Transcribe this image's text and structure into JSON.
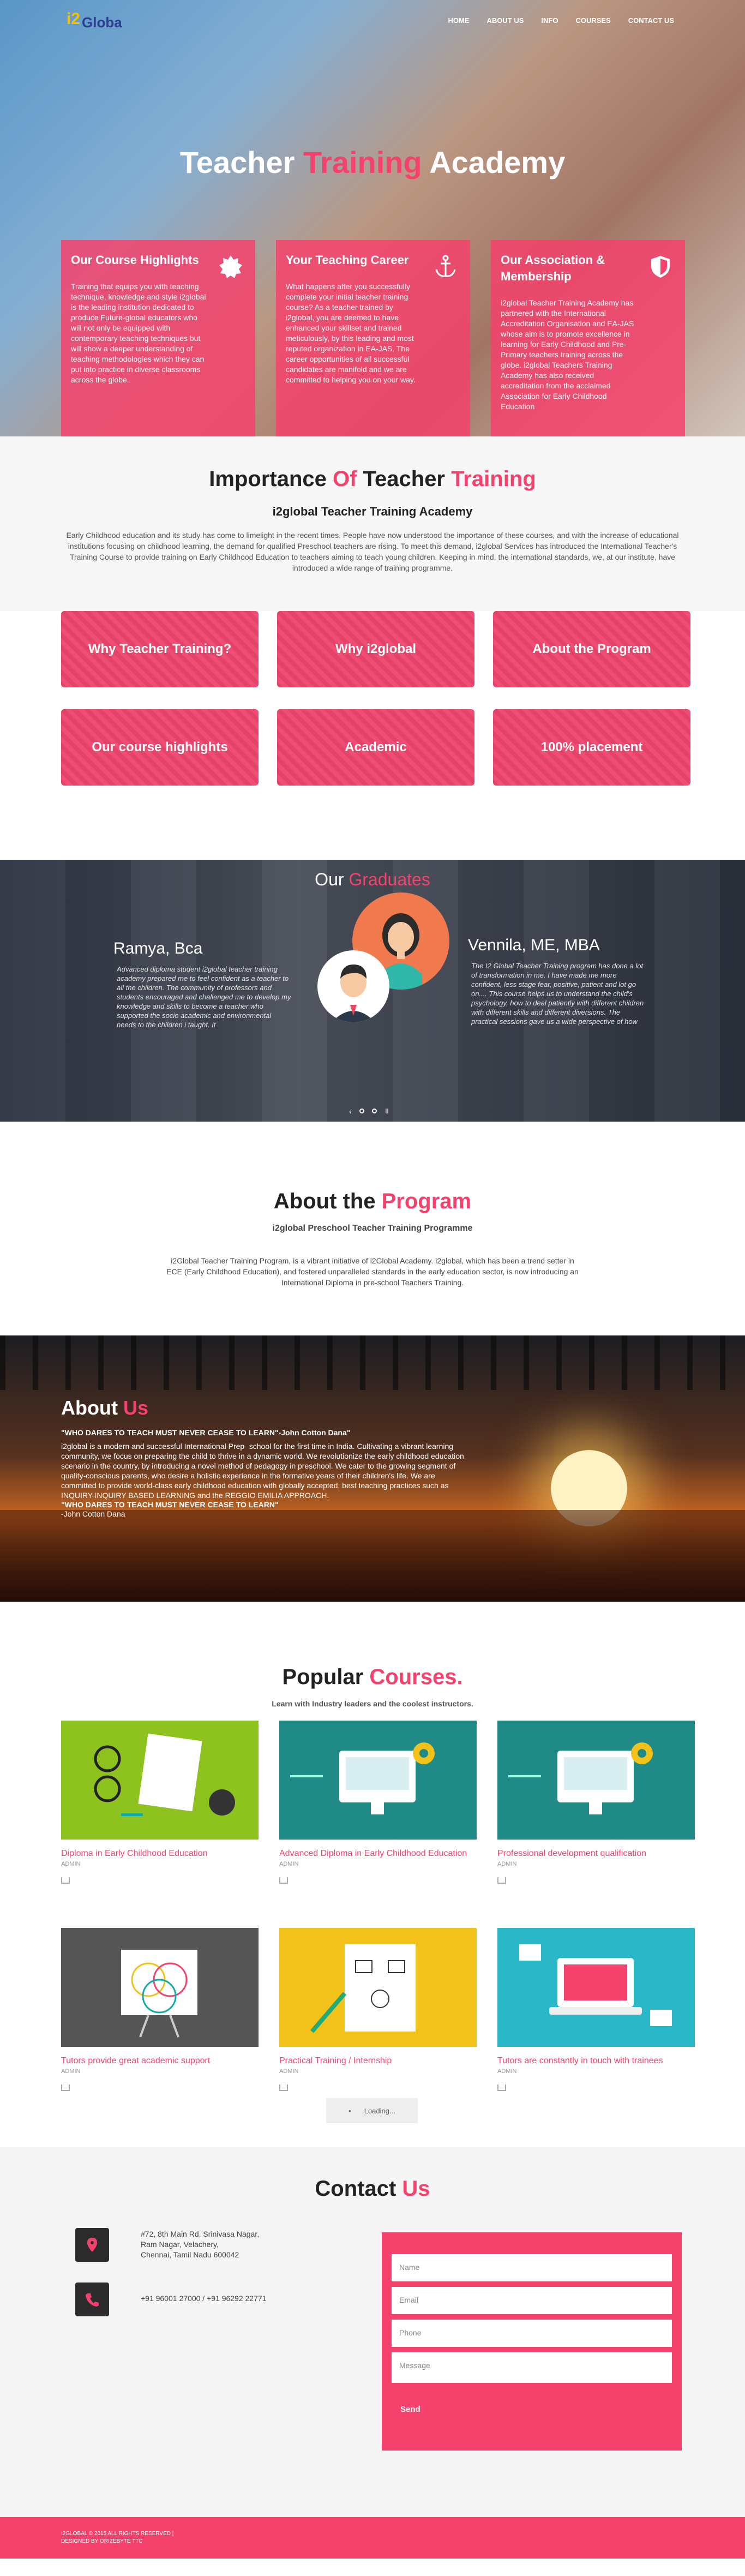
{
  "nav": {
    "logo_text": "Globa",
    "items": [
      "HOME",
      "ABOUT US",
      "INFO",
      "COURSES",
      "CONTACT US"
    ]
  },
  "hero": {
    "title_a": "Teacher ",
    "title_b": "Training",
    "title_c": " Academy",
    "cards": [
      {
        "title": "Our Course Highlights",
        "text": "Training that equips you with teaching technique, knowledge and style i2global is the leading institution dedicated to produce Future-global educators who will not only be equipped with contemporary teaching techniques but will show a deeper understanding of teaching methodologies which they can put into practice in diverse classrooms across the globe."
      },
      {
        "title": "Your Teaching Career",
        "text": "What happens after you successfully complete your initial teacher training course? As a teacher trained by i2global, you are deemed to have enhanced your skillset and trained meticulously, by this leading and most reputed organization in EA-JAS. The career opportunities of all successful candidates are manifold and we are committed to helping you on your way."
      },
      {
        "title": "Our Association & Membership",
        "text": "i2global Teacher Training Academy has partnered with the International Accreditation Organisation and EA-JAS whose aim is to promote excellence in learning for Early Childhood and Pre-Primary teachers training across the globe. i2global Teachers Training Academy has also received accreditation from the acclaimed Association for Early Childhood Education"
      }
    ]
  },
  "importance": {
    "title_a": "Importance ",
    "title_b": "Of",
    "title_c": " Teacher ",
    "title_d": "Training",
    "subtitle": "i2global Teacher Training Academy",
    "text": "Early Childhood education and its study has come to limelight in the recent times. People have now understood the importance of these courses, and with the increase of educational institutions focusing on childhood learning, the demand for qualified Preschool teachers are rising. To meet this demand, i2global Services has introduced the International Teacher's Training Course to provide training on Early Childhood Education to teachers aiming to teach young children. Keeping in mind, the international standards, we, at our institute, have introduced a wide range of training programme."
  },
  "tiles": [
    "Why Teacher Training?",
    "Why i2global",
    "About the Program",
    "Our course highlights",
    "Academic",
    "100% placement"
  ],
  "graduates": {
    "title_a": "Our ",
    "title_b": "Graduates",
    "left_name": "Ramya, Bca",
    "left_text": "Advanced diploma student i2global teacher training academy prepared me to feel confident as a teacher to all the children. The community of professors and students encouraged and challenged me to develop my knowledge and skills to become a teacher who supported the socio academic and environmental needs to the children i taught. It",
    "right_name": "Vennila, ME, MBA",
    "right_text": "The I2 Global Teacher Training program has done a lot of transformation in me. I have made me more confident, less stage fear, positive, patient and lot go on.... This course helps us to understand the child's psychology, how to deal patiently with different children with different skills and different diversions. The practical sessions gave us a wide perspective of how"
  },
  "program": {
    "title_a": "About the ",
    "title_b": "Program",
    "subtitle": "i2global Preschool Teacher Training Programme",
    "text": "i2Global Teacher Training Program, is a vibrant initiative of i2Global Academy. i2global, which has been a trend setter in ECE (Early Childhood Education), and fostered unparalleled standards in the early education sector, is now introducing an International Diploma in pre-school Teachers Training."
  },
  "aboutus": {
    "title_a": "About ",
    "title_b": "Us",
    "quote": "\"WHO DARES TO TEACH MUST NEVER CEASE TO LEARN\"-John Cotton Dana\"",
    "text": "i2global is a modern and successful International Prep- school for the first time in India. Cultivating a vibrant learning community, we focus on preparing the child to thrive in a dynamic world. We revolutionize the early childhood education scenario in the country, by introducing a novel method of pedagogy in preschool. We cater to the growing segment of quality-conscious parents, who desire a holistic experience in the formative years of their children's life. We are committed to provide world-class early childhood education with globally accepted, best teaching practices such as INQUIRY-INQUIRY BASED LEARNING and the REGGIO EMILIA APPROACH.",
    "quote2": "\"WHO DARES TO TEACH MUST NEVER CEASE TO LEARN\"",
    "author": "-John Cotton Dana"
  },
  "courses": {
    "title_a": "Popular ",
    "title_b": "Courses.",
    "subtitle": "Learn with Industry leaders and the coolest instructors.",
    "items": [
      {
        "title": "Diploma in Early Childhood Education",
        "meta": "ADMIN",
        "color": "#8dc21f"
      },
      {
        "title": "Advanced Diploma in Early Childhood Education",
        "meta": "ADMIN",
        "color": "#1f8a86"
      },
      {
        "title": "Professional development qualification",
        "meta": "ADMIN",
        "color": "#1f8a86"
      },
      {
        "title": "Tutors provide great academic support",
        "meta": "ADMIN",
        "color": "#555555"
      },
      {
        "title": "Practical Training / Internship",
        "meta": "ADMIN",
        "color": "#f2c21b"
      },
      {
        "title": "Tutors are constantly in touch with trainees",
        "meta": "ADMIN",
        "color": "#2ab8c8"
      }
    ],
    "loading": "Loading..."
  },
  "contact": {
    "title_a": "Contact ",
    "title_b": "Us",
    "address": [
      "#72, 8th Main Rd, Srinivasa Nagar,",
      "Ram Nagar, Velachery,",
      "Chennai, Tamil Nadu 600042"
    ],
    "phone": "+91 96001 27000 / +91 96292 22771",
    "fields": [
      "Name",
      "Email",
      "Phone",
      "Message"
    ],
    "send": "Send"
  },
  "footer": {
    "line1": "I2GLOBAL © 2015 ALL RIGHTS RESERVED |",
    "line2": "DESIGNED BY ORIZEBYTE TTC"
  },
  "colors": {
    "accent": "#f5426c",
    "dark": "#2b2b2b"
  }
}
